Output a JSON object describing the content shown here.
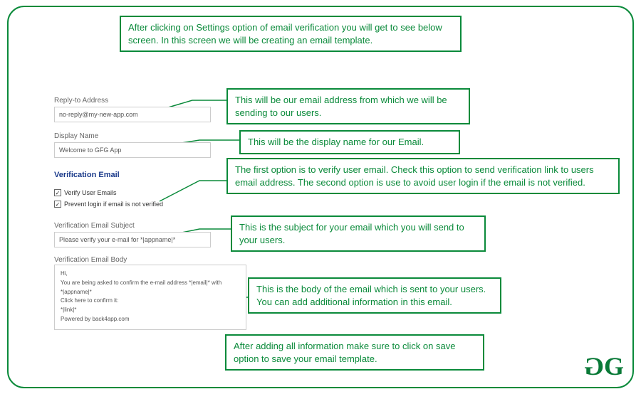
{
  "intro": "After clicking on Settings option of email verification you will get to see below screen. In this screen we will be creating an email template.",
  "form": {
    "replyTo": {
      "label": "Reply-to Address",
      "value": "no-reply@my-new-app.com"
    },
    "displayName": {
      "label": "Display Name",
      "value": "Welcome to GFG App"
    },
    "sectionTitle": "Verification Email",
    "checkbox1": "Verify User Emails",
    "checkbox2": "Prevent login if email is not verified",
    "subject": {
      "label": "Verification Email Subject",
      "value": "Please verify your e-mail for *|appname|*"
    },
    "body": {
      "label": "Verification Email Body",
      "l1": "Hi,",
      "l2": "You are being asked to confirm the e-mail address *|email|* with *|appname|*",
      "l3": "Click here to confirm it:",
      "l4": "*|link|*",
      "l5": "Powered by back4app.com"
    }
  },
  "callouts": {
    "replyTo": "This will be our email address from which we will be sending to our users.",
    "displayName": "This will be the display name for our Email.",
    "verification": "The first option is to verify user email. Check this option to send verification link to users email address. The second option is use to avoid user login if the email is not verified.",
    "subject": "This is the subject for your email which you will send to your users.",
    "body": "This is the body of the email which is sent to your users. You can add additional information in this email.",
    "save": "After adding all information make sure to click on save option to save your email template."
  },
  "logo": {
    "g1": "G",
    "g2": "G"
  }
}
